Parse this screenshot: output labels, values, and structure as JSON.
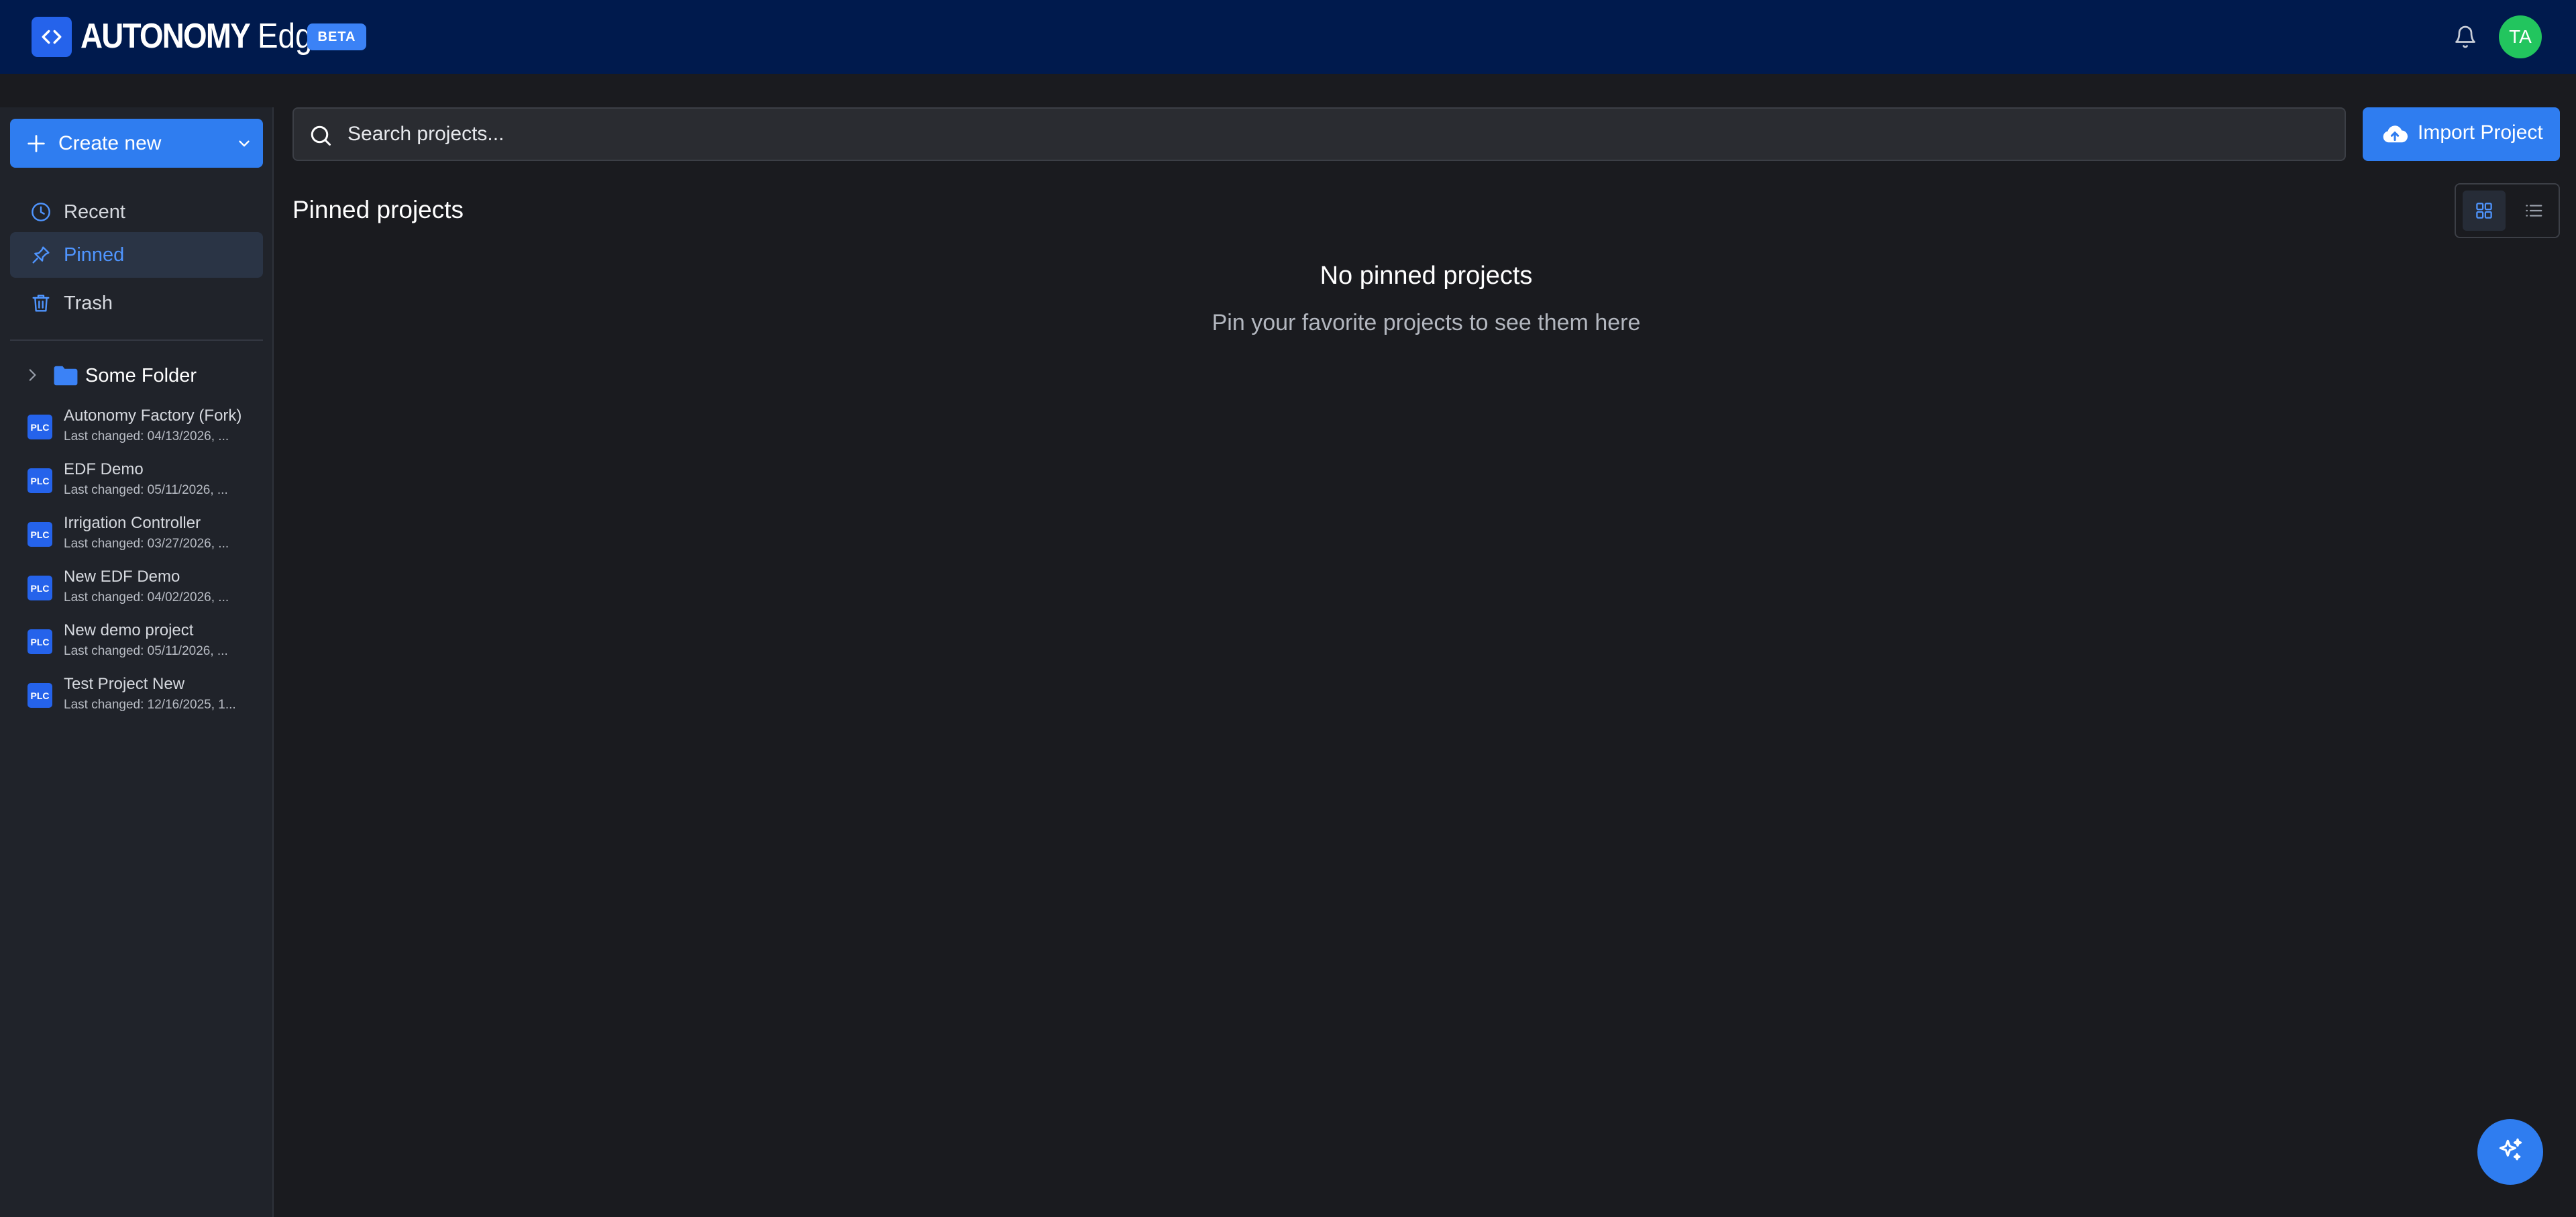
{
  "header": {
    "brand_strong": "AUTONOMY",
    "brand_light": "Edge",
    "badge": "BETA",
    "avatar_initials": "TA",
    "colors": {
      "bar": "#001a4d",
      "accent": "#2563eb",
      "avatar": "#22c55e"
    }
  },
  "sidebar": {
    "create_label": "Create new",
    "nav": [
      {
        "label": "Recent",
        "icon": "clock-icon",
        "active": false
      },
      {
        "label": "Pinned",
        "icon": "pin-icon",
        "active": true
      },
      {
        "label": "Trash",
        "icon": "trash-icon",
        "active": false
      }
    ],
    "folder": {
      "label": "Some Folder",
      "icon": "folder-icon"
    },
    "projects": [
      {
        "badge": "PLC",
        "name": "Autonomy Factory (Fork)",
        "meta": "Last changed: 04/13/2026, ..."
      },
      {
        "badge": "PLC",
        "name": "EDF Demo",
        "meta": "Last changed: 05/11/2026, ..."
      },
      {
        "badge": "PLC",
        "name": "Irrigation Controller",
        "meta": "Last changed: 03/27/2026, ..."
      },
      {
        "badge": "PLC",
        "name": "New EDF Demo",
        "meta": "Last changed: 04/02/2026, ..."
      },
      {
        "badge": "PLC",
        "name": "New demo project",
        "meta": "Last changed: 05/11/2026, ..."
      },
      {
        "badge": "PLC",
        "name": "Test Project New",
        "meta": "Last changed: 12/16/2025, 1..."
      }
    ]
  },
  "main": {
    "search": {
      "placeholder": "Search projects...",
      "value": ""
    },
    "import_label": "Import Project",
    "section_title": "Pinned projects",
    "view_mode": "grid",
    "empty": {
      "title": "No pinned projects",
      "subtitle": "Pin your favorite projects to see them here"
    }
  }
}
